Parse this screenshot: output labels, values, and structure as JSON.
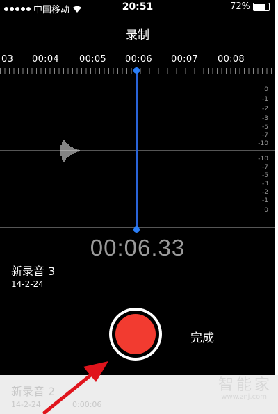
{
  "status_bar": {
    "carrier": "中国移动",
    "time": "20:51",
    "battery": "72%",
    "battery_level": 0.72
  },
  "title": "录制",
  "timeline": {
    "labels": [
      "03",
      "00:04",
      "00:05",
      "00:06",
      "00:07",
      "00:08"
    ]
  },
  "db_scale": [
    "0",
    "-1",
    "-2",
    "-3",
    "-5",
    "-7",
    "-10",
    "-10",
    "-7",
    "-5",
    "-3",
    "-2",
    "-1",
    "0"
  ],
  "timer": "00:06.33",
  "recording": {
    "name": "新录音 3",
    "date": "14-2-24"
  },
  "done_label": "完成",
  "previous_recording": {
    "name": "新录音 2",
    "date": "14-2-24",
    "duration": "0:00:06"
  },
  "watermark": "智能家",
  "watermark_url": "www.znj.com",
  "colors": {
    "record": "#f23b30",
    "playhead": "#2a64d9"
  }
}
